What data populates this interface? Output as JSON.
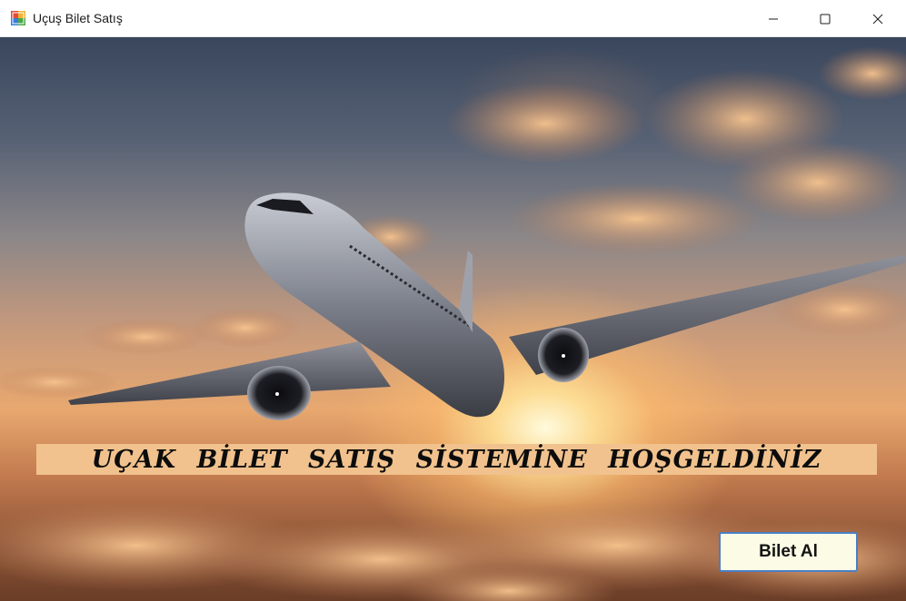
{
  "window": {
    "title": "Uçuş Bilet Satış",
    "controls": [
      "minimize",
      "maximize",
      "close"
    ]
  },
  "main": {
    "banner_text": "UÇAK  BİLET SATIŞ  SİSTEMİNE  HOŞGELDİNİZ",
    "buy_button_label": "Bilet Al"
  },
  "colors": {
    "banner_bg": "#f1c28e",
    "button_bg": "#fbfbe6",
    "button_border": "#4a7fc7"
  }
}
